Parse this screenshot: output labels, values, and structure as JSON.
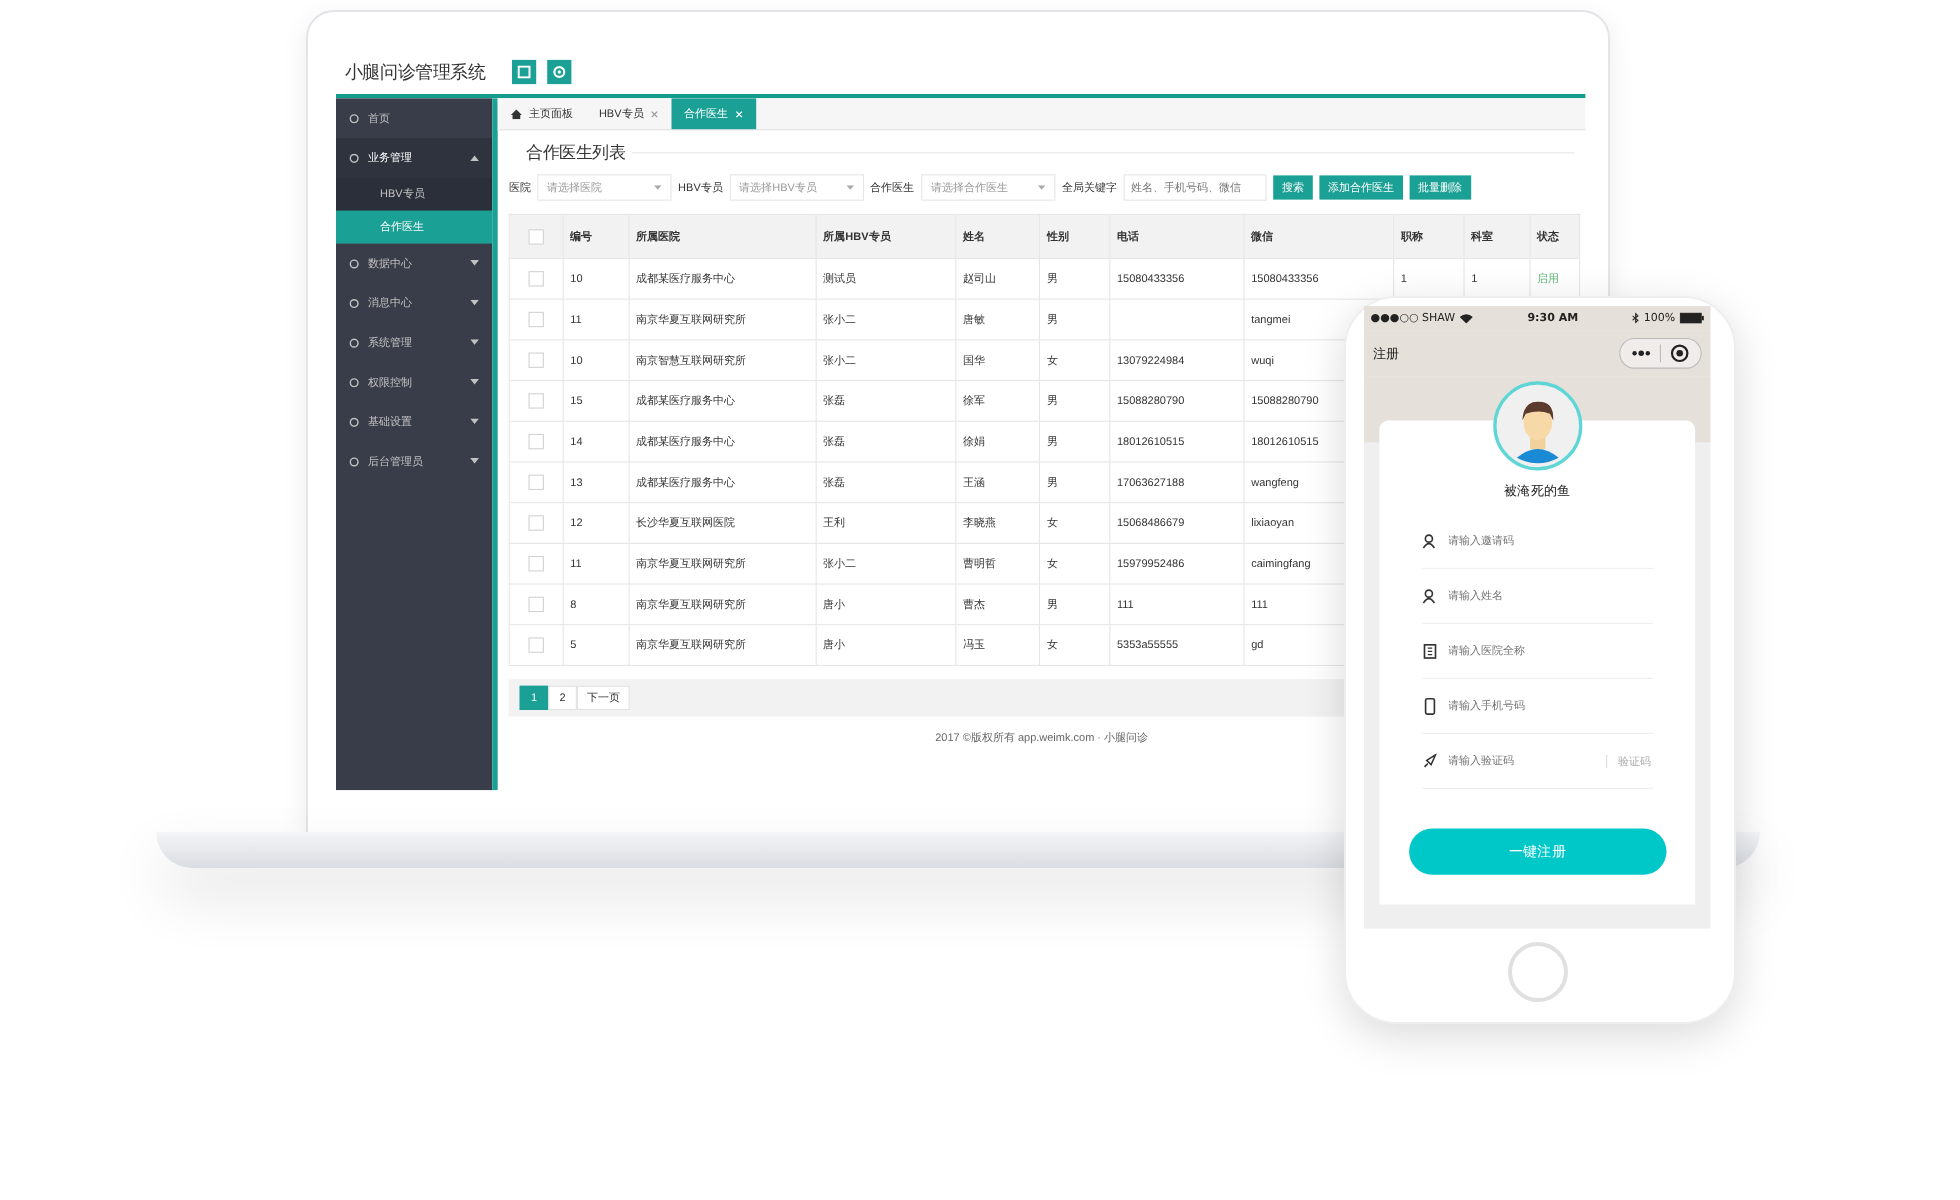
{
  "admin": {
    "title": "小腿问诊管理系统",
    "sidebar": [
      {
        "label": "首页",
        "selected": false
      },
      {
        "label": "业务管理",
        "selected": false,
        "expanded": true,
        "children": [
          {
            "label": "HBV专员",
            "selected": false
          },
          {
            "label": "合作医生",
            "selected": true
          }
        ]
      },
      {
        "label": "数据中心",
        "selected": false,
        "expanded": false
      },
      {
        "label": "消息中心",
        "selected": false,
        "expanded": false
      },
      {
        "label": "系统管理",
        "selected": false,
        "expanded": false
      },
      {
        "label": "权限控制",
        "selected": false,
        "expanded": false
      },
      {
        "label": "基础设置",
        "selected": false,
        "expanded": false
      },
      {
        "label": "后台管理员",
        "selected": false,
        "expanded": false
      }
    ],
    "tabs": [
      {
        "label": "主页面板",
        "selected": false,
        "kind": "home"
      },
      {
        "label": "HBV专员",
        "selected": false,
        "kind": "closable"
      },
      {
        "label": "合作医生",
        "selected": true,
        "kind": "closable"
      }
    ],
    "panel_title": "合作医生列表",
    "filters": [
      {
        "kind": "select",
        "label": "医院",
        "placeholder": "请选择医院"
      },
      {
        "kind": "select",
        "label": "HBV专员",
        "placeholder": "请选择HBV专员"
      },
      {
        "kind": "select",
        "label": "合作医生",
        "placeholder": "请选择合作医生"
      },
      {
        "kind": "input",
        "label": "全局关键字",
        "placeholder": "姓名、手机号码、微信"
      }
    ],
    "buttons": [
      "搜索",
      "添加合作医生",
      "批量删除"
    ],
    "table": {
      "header_checked": false,
      "columns": [
        {
          "label": "编号",
          "kind": "text"
        },
        {
          "label": "所属医院",
          "kind": "text"
        },
        {
          "label": "所属HBV专员",
          "kind": "text"
        },
        {
          "label": "姓名",
          "kind": "text"
        },
        {
          "label": "性别",
          "kind": "text"
        },
        {
          "label": "电话",
          "kind": "text"
        },
        {
          "label": "微信",
          "kind": "text"
        },
        {
          "label": "职称",
          "kind": "text"
        },
        {
          "label": "科室",
          "kind": "text"
        },
        {
          "label": "状态",
          "kind": "status"
        }
      ],
      "rows": [
        {
          "checked": false,
          "cells": [
            "10",
            "成都某医疗服务中心",
            "测试员",
            "赵司山",
            "男",
            "15080433356",
            "15080433356",
            "1",
            "1",
            "启用"
          ]
        },
        {
          "checked": false,
          "cells": [
            "11",
            "南京华夏互联网研究所",
            "张小二",
            "唐敏",
            "男",
            null,
            "tangmei"
          ]
        },
        {
          "checked": false,
          "cells": [
            "10",
            "南京智慧互联网研究所",
            "张小二",
            "国华",
            "女",
            "13079224984",
            "wuqi"
          ]
        },
        {
          "checked": false,
          "cells": [
            "15",
            "成都某医疗服务中心",
            "张磊",
            "徐军",
            "男",
            "15088280790",
            "15088280790"
          ]
        },
        {
          "checked": false,
          "cells": [
            "14",
            "成都某医疗服务中心",
            "张磊",
            "徐娟",
            "男",
            "18012610515",
            "18012610515"
          ]
        },
        {
          "checked": false,
          "cells": [
            "13",
            "成都某医疗服务中心",
            "张磊",
            "王涵",
            "男",
            "17063627188",
            "wangfeng"
          ]
        },
        {
          "checked": false,
          "cells": [
            "12",
            "长沙华夏互联网医院",
            "王利",
            "李晓燕",
            "女",
            "15068486679",
            "lixiaoyan"
          ]
        },
        {
          "checked": false,
          "cells": [
            "11",
            "南京华夏互联网研究所",
            "张小二",
            "曹明哲",
            "女",
            "15979952486",
            "caimingfang"
          ]
        },
        {
          "checked": false,
          "cells": [
            "8",
            "南京华夏互联网研究所",
            "唐小",
            "曹杰",
            "男",
            "111",
            "111"
          ]
        },
        {
          "checked": false,
          "cells": [
            "5",
            "南京华夏互联网研究所",
            "唐小",
            "冯玉",
            "女",
            "5353a55555",
            "gd"
          ]
        }
      ]
    },
    "pagination": [
      {
        "label": "1",
        "selected": true
      },
      {
        "label": "2",
        "selected": false
      },
      {
        "label": "下一页",
        "selected": false
      }
    ],
    "footer": "2017 ©版权所有 app.weimk.com · 小腿问诊"
  },
  "phone": {
    "carrier": "●●●○○ SHAW",
    "time": "9:30 AM",
    "battery": "100%",
    "nav_title": "注册",
    "user_name": "被淹死的鱼",
    "fields": [
      {
        "kind": "user",
        "placeholder": "请输入邀请码"
      },
      {
        "kind": "user",
        "placeholder": "请输入姓名"
      },
      {
        "kind": "building",
        "placeholder": "请输入医院全称"
      },
      {
        "kind": "phone",
        "placeholder": "请输入手机号码"
      },
      {
        "kind": "rocket",
        "placeholder": "请输入验证码",
        "action": "验证码"
      }
    ],
    "submit": "一键注册"
  }
}
